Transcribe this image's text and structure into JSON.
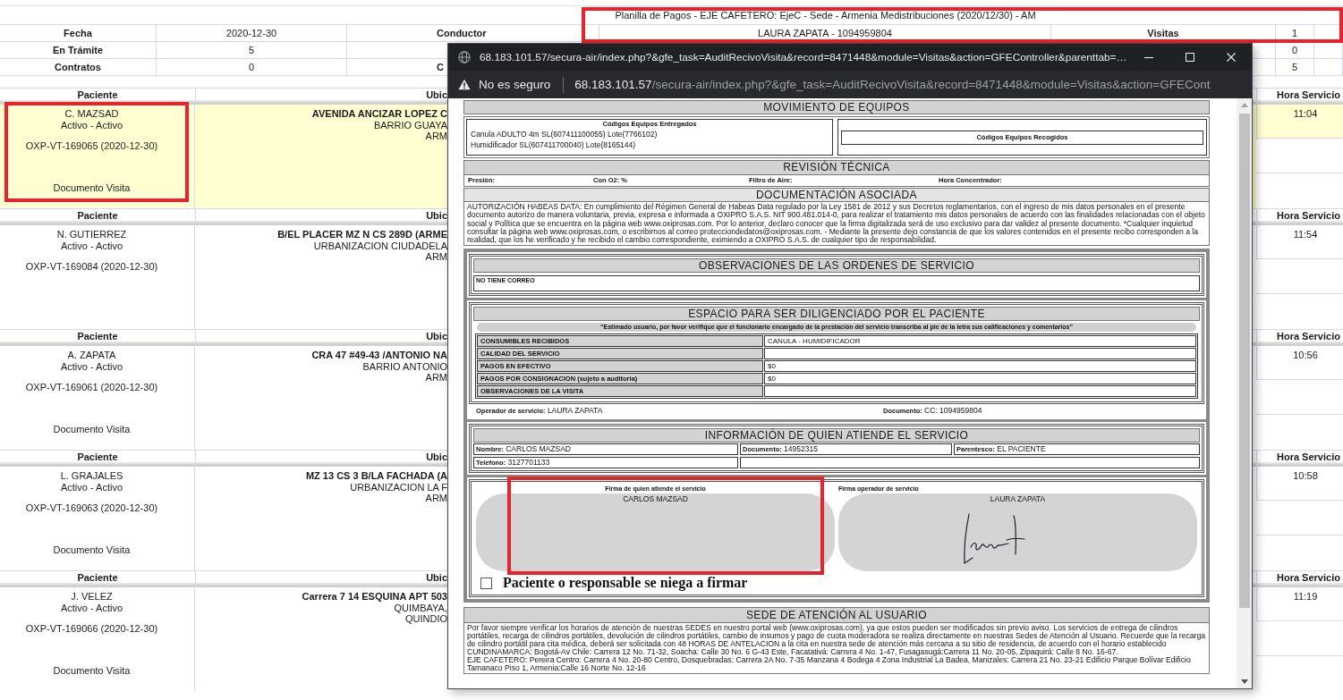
{
  "header": {
    "title": "Planilla de Pagos - EJE CAFETERO: EjeC - Sede - Armenia Medistribuciones (2020/12/30) - AM",
    "highlighted": true,
    "rows": [
      {
        "label": "Fecha",
        "value": "2020-12-30",
        "label_2": "Conductor",
        "value_2": "LAURA ZAPATA - 1094959804",
        "label_3": "Visitas",
        "value_3": "1"
      },
      {
        "label": "En Trámite",
        "value": "5",
        "value_3": "0"
      },
      {
        "label": "Contratos",
        "value": "0",
        "label_2": "C",
        "value_3": "5"
      }
    ]
  },
  "patients": [
    {
      "headers": [
        "Paciente",
        "Ubic",
        "Hora Servicio"
      ],
      "name": "C. MAZSAD",
      "status": "Activo - Activo",
      "visit": "OXP-VT-169065 (2020-12-30)",
      "document": "Documento Visita",
      "address": "AVENIDA ANCIZAR LOPEZ C",
      "neighborhood": "BARRIO GUAYA",
      "city": "ARM",
      "time": "11:04",
      "selected": true,
      "highlighted": true
    },
    {
      "headers": [
        "Paciente",
        "Ubic",
        "Hora Servicio"
      ],
      "name": "N. GUTIERREZ",
      "status": "Activo - Activo",
      "visit": "OXP-VT-169084 (2020-12-30)",
      "address": "B/EL PLACER MZ N CS 289D (ARME",
      "neighborhood": "URBANIZACION CIUDADELA",
      "city": "ARM",
      "time": "11:54",
      "selected": false,
      "highlighted": false
    },
    {
      "headers": [
        "Paciente",
        "Ubic",
        "Hora Servicio"
      ],
      "name": "A. ZAPATA",
      "status": "Activo - Activo",
      "visit": "OXP-VT-169061 (2020-12-30)",
      "document": "Documento Visita",
      "address": "CRA 47 #49-43 /ANTONIO NA",
      "neighborhood": "BARRIO ANTONIO",
      "city": "ARM",
      "time": "10:56",
      "selected": false,
      "highlighted": false
    },
    {
      "headers": [
        "Paciente",
        "Ubic",
        "Hora Servicio"
      ],
      "name": "L. GRAJALES",
      "status": "Activo - Activo",
      "visit": "OXP-VT-169063 (2020-12-30)",
      "document": "Documento Visita",
      "address": "MZ 13 CS 3 B/LA FACHADA (A",
      "neighborhood": "URBANIZACION LA F",
      "city": "ARM",
      "time": "10:58",
      "selected": false,
      "highlighted": false
    },
    {
      "headers": [
        "Paciente",
        "Ubic",
        "Hora Servicio"
      ],
      "name": "J. VELEZ",
      "status": "Activo - Activo",
      "visit": "OXP-VT-169066 (2020-12-30)",
      "document": "Documento Visita",
      "address": "Carrera 7 14 ESQUINA APT 503",
      "neighborhood": "QUIMBAYA,",
      "city": "QUINDIO",
      "time": "11:19",
      "selected": false,
      "highlighted": false
    }
  ],
  "popup": {
    "title": "68.183.101.57/secura-air/index.php?&gfe_task=AuditRecivoVisita&record=8471448&module=Visitas&action=GFEController&parenttab=…",
    "security_label": "No es seguro",
    "url": {
      "host": "68.183.101.57",
      "path": "/secura-air/index.php?&gfe_task=AuditRecivoVisita&record=8471448&module=Visitas&action=GFECont"
    },
    "document": {
      "equipment": {
        "title": "MOVIMIENTO DE EQUIPOS",
        "delivered_title": "Códigos Equipos Entregados",
        "delivered": [
          "Canula ADULTO 4m SL(607411100055) Lote(7766102)",
          "Humidificador SL(607411700040) Lote(8165144)"
        ],
        "collected_title": "Códigos Equipos Recogidos"
      },
      "technical_review": {
        "title": "REVISIÓN TÉCNICA",
        "fields": [
          "Presión:",
          "Con O2: %",
          "Filtro de Aire:",
          "Hora Concentrador:"
        ]
      },
      "documentation": {
        "title": "DOCUMENTACIÓN ASOCIADA",
        "text": "AUTORIZACIÓN HABEAS DATA: En cumplimiento del Régimen General de Habeas Data regulado por la Ley 1581 de 2012 y sus Decretos reglamentarios, con el ingreso de mis datos personales en el presente documento autorizo de manera voluntaria, previa, expresa e informada a OXIPRO S.A.S. NIT 900.481.014-0, para realizar el tratamiento mis datos personales de acuerdo con las finalidades relacionadas con el objeto social y Política que se encuentra en la página web www.oxiprosas.com. Por lo anterior, declaro conocer que la firma digitalizada será de uso exclusivo para dar validez al presente documento. *Cualquier inquietud consultar la página web www.oxiprosas.com, o escribirnos al correo protecciondedatos@oxiprosas.com. - Mediante la presente dejo constancia de que los valores contenidos en el presente recibo corresponden a la realidad, que los he verificado y he recibido el cambio correspondiente, eximiendo a OXIPRO S.A.S. de cualquier tipo de responsabilidad."
      },
      "observations": {
        "title": "OBSERVACIONES DE LAS ORDENES DE SERVICIO",
        "text": "NO TIENE CORREO"
      },
      "patient_section": {
        "title": "ESPACIO PARA SER DILIGENCIADO POR EL PACIENTE",
        "notice": "“Estimado usuario, por favor verifique que el funcionario encargado de la prestación del servicio transcriba al pie de la letra sus calificaciones y comentarios”",
        "rows": [
          {
            "label": "CONSUMIBLES RECIBIDOS",
            "value": "CANULA - HUMIDIFICADOR"
          },
          {
            "label": "CALIDAD DEL SERVICIO"
          },
          {
            "label": "PAGOS EN EFECTIVO",
            "value": "$0"
          },
          {
            "label": "PAGOS POR CONSIGNACION (sujeto a auditoria)",
            "value": "$0"
          },
          {
            "label": "OBSERVACIONES DE LA VISITA"
          }
        ],
        "operator": "**Operador de servicio:** LAURA ZAPATA",
        "operator_document": "**Documento:** CC: 1094959804"
      },
      "attendee": {
        "title": "INFORMACIÓN DE QUIEN ATIENDE EL SERVICIO",
        "name": "**Nombre:** CARLOS MAZSAD",
        "document": "**Documento:** 14952315",
        "relationship": "**Parentesco:** EL PACIENTE",
        "phone": "**Telefono:** 3127701133"
      },
      "signatures": [
        {
          "label": "Firma de quien atiende el servicio",
          "name": "CARLOS MAZSAD",
          "signed": false,
          "highlighted": true
        },
        {
          "label": "Firma operador de servicio",
          "name": "LAURA ZAPATA",
          "signed": true,
          "highlighted": false
        }
      ],
      "refuse_to_sign": {
        "label": "Paciente o responsable se niega a firmar",
        "checked": false
      },
      "offices": {
        "title": "SEDE DE ATENCIÓN AL USUARIO",
        "paragraphs": [
          "Por favor siempre verificar los horarios de atención de nuestras SEDES en nuestro portal web (www.oxiprosas.com), ya que estos pueden ser modificados sin previo aviso. Los servicios de entrega de cilindros portátiles, recarga de cilindros portátiles, devolución de cilindros portátiles, cambio de insumos y pago de cuota moderadora se realiza directamente en nuestras Sedes de Atención al Usuario. Recuerde que la recarga de cilindro portátil para cita médica, deberá ser solicitada con 48 HORAS DE ANTELACION a la cita en nuestra sede de atención más cercana a su sitio de residencia, de acuerdo con el horario establecido",
          "CUNDINAMARCA: Bogotá-Av Chile: Carrera 12 No. 71-32, Soacha: Calle 30 No. 6 G-43 Este, Facatativá: Carrera 4 No. 1-47, Fusagasugá:Carrera 11 No. 20-05, Zipaquirá: Calle 8 No. 16-67.",
          "EJE CAFETERO: Pereira Centro: Carrera 4 No. 20-80 Centro, Dosquebradas: Carrera 2A No. 7-35 Manzana 4 Bodega 4 Zona Industrial La Badea, Manizales: Carrera 21 No. 23-21 Edificio Parque Bolívar Edificio Tamanaco Piso 1, Armenia:Calle 16 Norte No. 12-16"
        ]
      }
    }
  }
}
